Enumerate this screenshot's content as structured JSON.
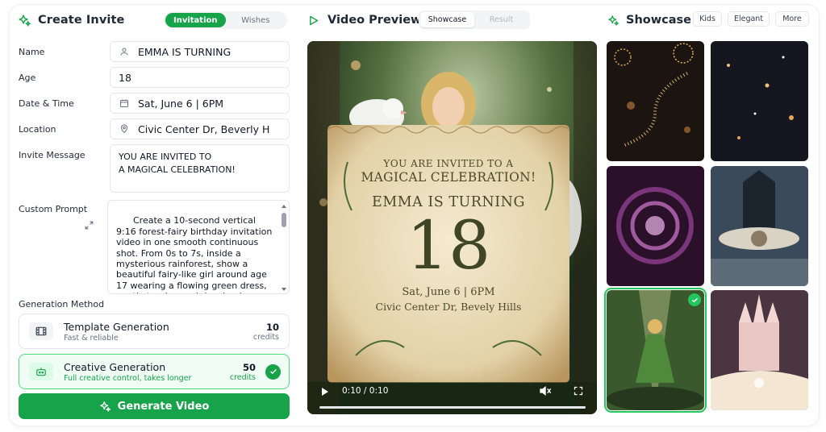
{
  "create": {
    "title": "Create Invite",
    "tabs": [
      "Invitation",
      "Wishes"
    ],
    "active_tab": "Invitation",
    "fields": {
      "name": {
        "label": "Name",
        "value": "EMMA IS TURNING"
      },
      "age": {
        "label": "Age",
        "value": "18"
      },
      "date": {
        "label": "Date & Time",
        "value": "Sat, June 6 | 6PM"
      },
      "location": {
        "label": "Location",
        "value": "Civic Center Dr, Beverly H"
      },
      "message": {
        "label": "Invite Message",
        "value": "YOU ARE INVITED TO\nA MAGICAL CELEBRATION!"
      },
      "prompt": {
        "label": "Custom Prompt",
        "value": "Create a 10-second vertical 9:16 forest-fairy birthday invitation video in one smooth continuous shot. From 0s to 7s, inside a mysterious rainforest, show a beautiful fairy-like girl around age 17 wearing a flowing green dress, gently turning and dancing in"
      }
    },
    "method_label": "Generation Method",
    "methods": [
      {
        "title": "Template Generation",
        "subtitle": "Fast & reliable",
        "credits": "10",
        "unit": "credits",
        "selected": false
      },
      {
        "title": "Creative Generation",
        "subtitle": "Full creative control, takes longer",
        "credits": "50",
        "unit": "credits",
        "selected": true
      }
    ],
    "generate_label": "Generate Video",
    "accent": "#16a34a"
  },
  "preview": {
    "title": "Video Preview",
    "tabs": [
      "Showcase",
      "Result"
    ],
    "active_tab": "Showcase",
    "invitation": {
      "line1": "YOU ARE INVITED TO A",
      "line2": "MAGICAL CELEBRATION!",
      "line3": "EMMA IS TURNING",
      "age": "18",
      "date": "Sat, June 6 | 6PM",
      "location": "Civic Center Dr, Bevely Hills"
    },
    "player": {
      "time": "0:10 / 0:10",
      "progress": 1.0
    }
  },
  "showcase": {
    "title": "Showcase",
    "chips": [
      "Kids",
      "Elegant",
      "More"
    ],
    "items": [
      {
        "theme": "golden-sparkle-fireworks",
        "selected": false
      },
      {
        "theme": "night-sky-bokeh",
        "selected": false
      },
      {
        "theme": "purple-galaxy-swirl",
        "selected": false
      },
      {
        "theme": "castle-owl",
        "selected": false
      },
      {
        "theme": "forest-fairy",
        "selected": true
      },
      {
        "theme": "fairytale-castle-book",
        "selected": false
      }
    ]
  }
}
